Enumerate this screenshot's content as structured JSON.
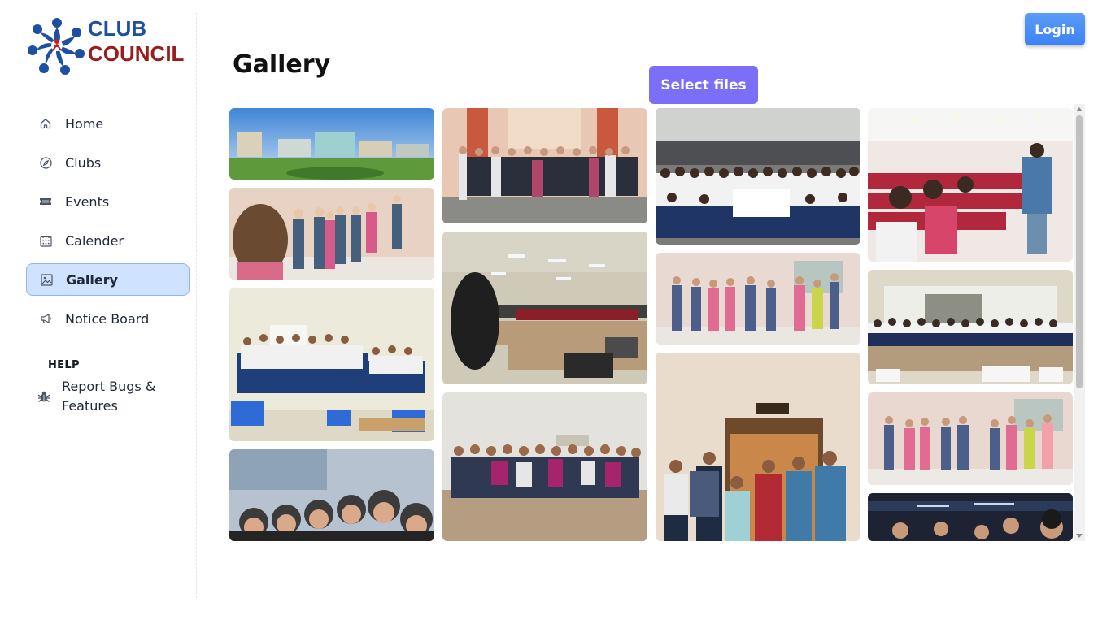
{
  "brand": {
    "line1": "CLUB",
    "line2": "COUNCIL"
  },
  "nav": {
    "items": [
      {
        "label": "Home",
        "icon": "home-icon"
      },
      {
        "label": "Clubs",
        "icon": "compass-icon"
      },
      {
        "label": "Events",
        "icon": "ticket-icon"
      },
      {
        "label": "Calender",
        "icon": "calendar-icon"
      },
      {
        "label": "Gallery",
        "icon": "image-icon",
        "active": true
      },
      {
        "label": "Notice Board",
        "icon": "megaphone-icon"
      }
    ]
  },
  "help": {
    "title": "HELP",
    "item_label": "Report Bugs & Features",
    "item_icon": "bug-icon"
  },
  "header": {
    "login_label": "Login"
  },
  "main": {
    "title": "Gallery",
    "select_files_label": "Select files"
  },
  "colors": {
    "accent_blue": "#3b82f6",
    "select_purple": "#7c6ff7",
    "active_nav_bg": "#cfe2ff",
    "brand_blue": "#1d4fa3",
    "brand_red": "#9b1c1c"
  }
}
